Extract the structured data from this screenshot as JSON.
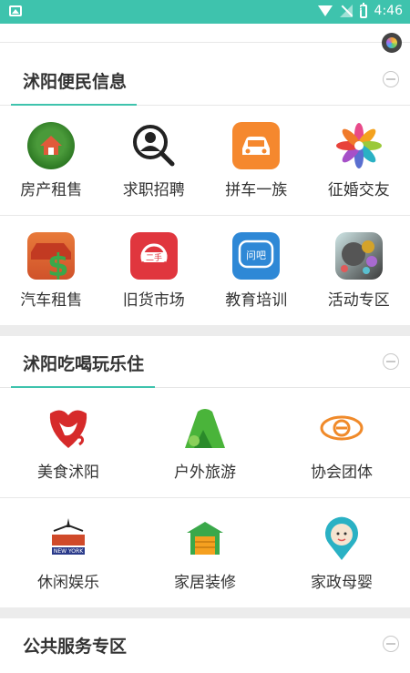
{
  "status": {
    "time": "4:46"
  },
  "sections": [
    {
      "title": "沭阳便民信息",
      "items": [
        "房产租售",
        "求职招聘",
        "拼车一族",
        "征婚交友",
        "汽车租售",
        "旧货市场",
        "教育培训",
        "活动专区"
      ]
    },
    {
      "title": "沭阳吃喝玩乐住",
      "items": [
        "美食沭阳",
        "户外旅游",
        "协会团体",
        "休闲娱乐",
        "家居装修",
        "家政母婴"
      ]
    },
    {
      "title": "公共服务专区",
      "items": []
    }
  ],
  "icons": {
    "used_market_text": "二手",
    "edu_text": "问吧",
    "leisure_text": "NEW YORK"
  }
}
